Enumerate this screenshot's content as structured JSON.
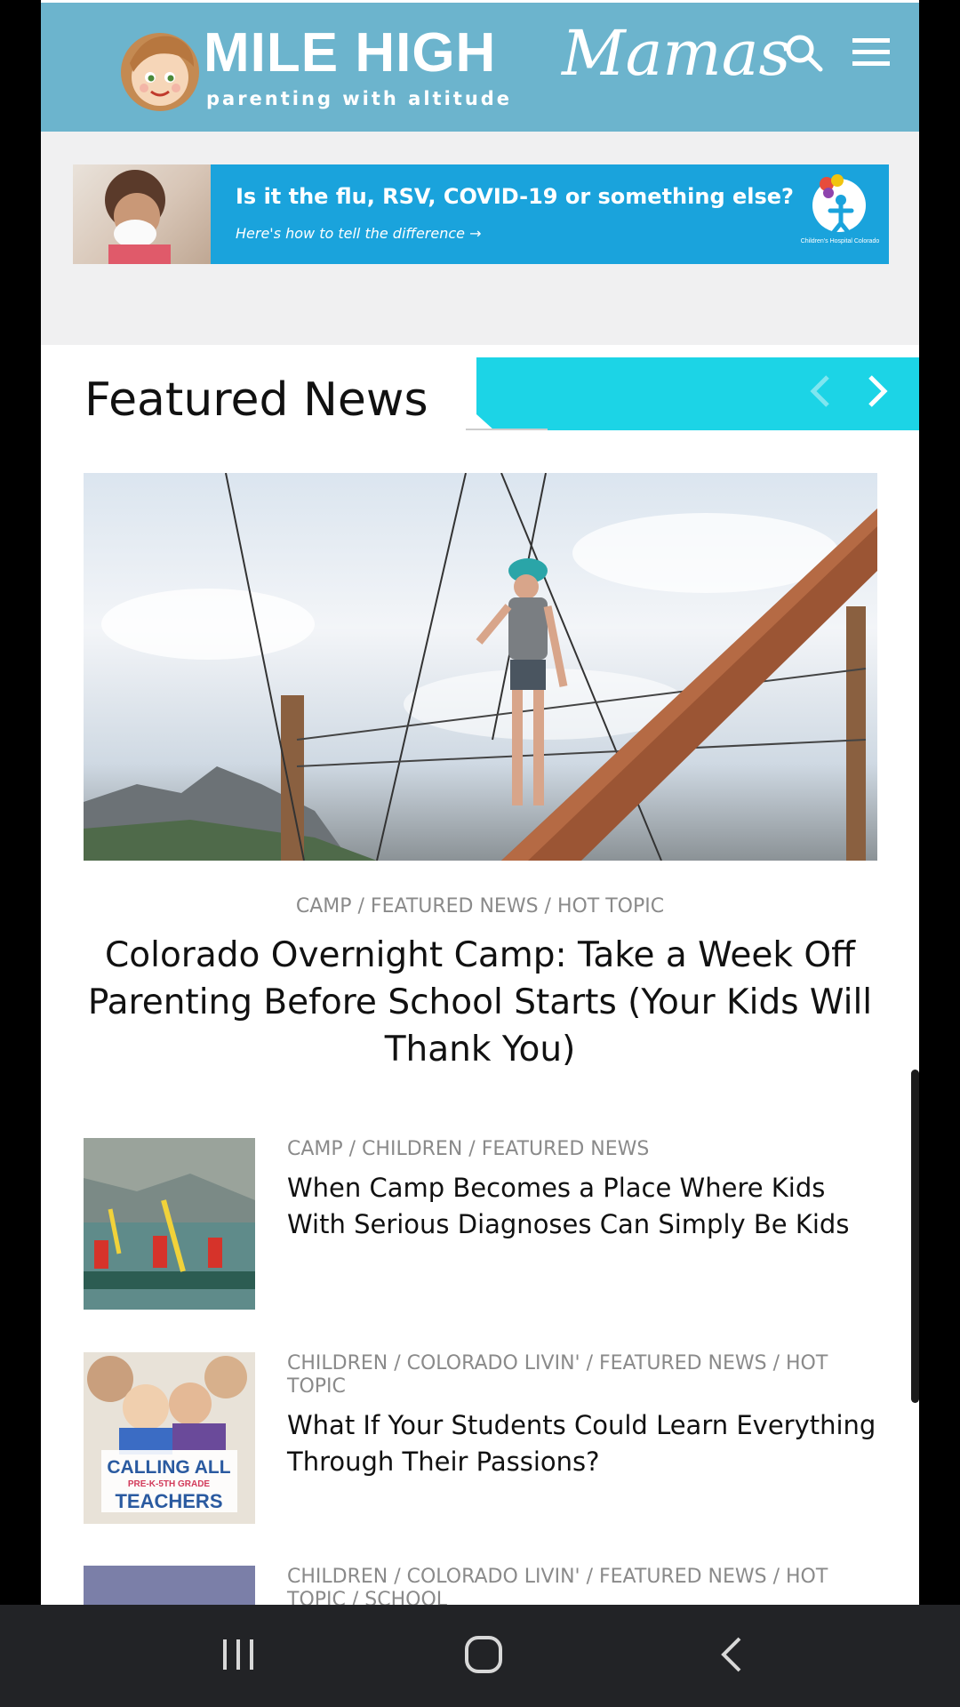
{
  "header": {
    "logo_main": "MILE HIGH",
    "logo_script": "Mamas",
    "logo_tagline": "parenting with altitude"
  },
  "ad": {
    "headline": "Is it the flu, RSV, COVID-19 or something else?",
    "subline": "Here's how to tell the difference →",
    "sponsor": "Children's Hospital Colorado"
  },
  "featured": {
    "title": "Featured News",
    "hero": {
      "categories": "CAMP / FEATURED NEWS / HOT TOPIC",
      "title": "Colorado Overnight Camp: Take a Week Off Parenting Before School Starts (Your Kids Will Thank You)"
    },
    "items": [
      {
        "categories": "CAMP / CHILDREN / FEATURED NEWS",
        "title": "When Camp Becomes a Place Where Kids With Serious Diagnoses Can Simply Be Kids"
      },
      {
        "categories": "CHILDREN / COLORADO LIVIN' / FEATURED NEWS / HOT TOPIC",
        "title": "What If Your Students Could Learn Everything Through Their Passions?",
        "thumb_text_1": "CALLING ALL",
        "thumb_text_2": "PRE-K-5TH GRADE",
        "thumb_text_3": "TEACHERS"
      },
      {
        "categories": "CHILDREN / COLORADO LIVIN' / FEATURED NEWS / HOT TOPIC / SCHOOL"
      }
    ]
  },
  "colors": {
    "header_bg": "#6cb4cd",
    "accent_cyan": "#1cd4e6",
    "ad_bg": "#1aa3dc",
    "navbar_bg": "#222326"
  },
  "icons": {
    "search": "search-icon",
    "menu": "hamburger-menu-icon",
    "prev": "chevron-left-icon",
    "next": "chevron-right-icon",
    "recents": "recent-apps-icon",
    "home": "home-icon",
    "back": "back-icon"
  }
}
